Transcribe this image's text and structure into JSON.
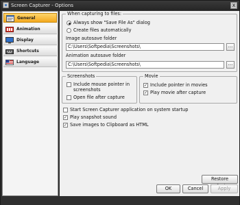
{
  "window": {
    "title": "Screen Capturer - Options",
    "close_glyph": "x"
  },
  "sidebar": {
    "items": [
      {
        "label": "General",
        "icon": "general-icon",
        "active": true
      },
      {
        "label": "Animation",
        "icon": "animation-icon",
        "active": false
      },
      {
        "label": "Display",
        "icon": "display-icon",
        "active": false
      },
      {
        "label": "Shortcuts",
        "icon": "keyboard-icon",
        "active": false
      },
      {
        "label": "Language",
        "icon": "language-icon",
        "active": false
      }
    ]
  },
  "capture_group": {
    "legend": "When capturing to files:",
    "radio_save_as": "Always show \"Save File As\" dialog",
    "radio_auto": "Create files automatically",
    "image_folder_label": "Image autosave folder",
    "image_folder_value": "C:\\Users\\Softpedia\\Screenshots\\",
    "anim_folder_label": "Animation autosave folder",
    "anim_folder_value": "C:\\Users\\Softpedia\\Screenshots\\",
    "browse_label": "..."
  },
  "screenshots_group": {
    "legend": "Screenshots",
    "include_pointer": "Include mouse pointer in screenshots",
    "open_after": "Open file after capture"
  },
  "movie_group": {
    "legend": "Movie",
    "include_pointer": "Include pointer in movies",
    "play_after": "Play movie after capture"
  },
  "options": {
    "startup": "Start Screen Capturer application on system startup",
    "play_sound": "Play snapshot sound",
    "clipboard_html": "Save images to Clipboard as HTML"
  },
  "check_glyph": "✓",
  "buttons": {
    "restore": "Restore Defaults",
    "ok": "OK",
    "cancel": "Cancel",
    "apply": "Apply"
  }
}
